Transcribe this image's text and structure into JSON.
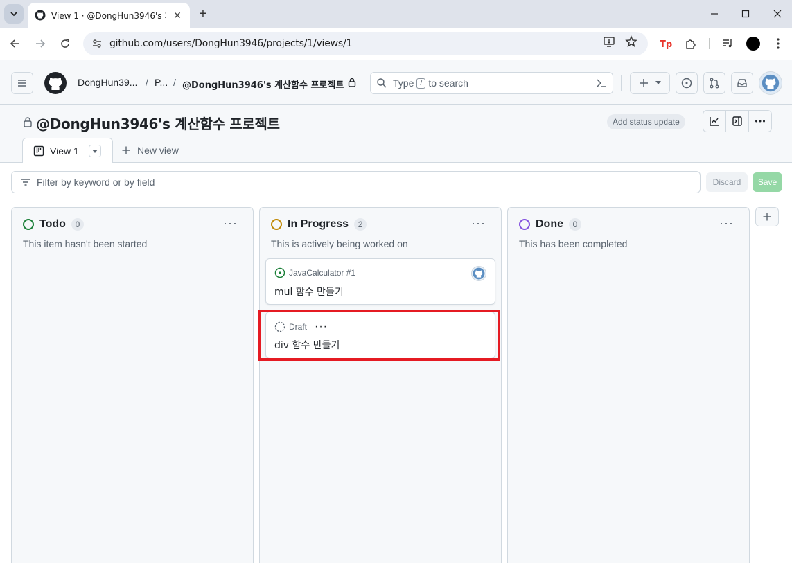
{
  "browser": {
    "tab_title": "View 1 · @DongHun3946's 계산함수 프로젝트",
    "url": "github.com/users/DongHun3946/projects/1/views/1"
  },
  "header": {
    "breadcrumb_owner": "DongHun39...",
    "breadcrumb_sep": "/",
    "breadcrumb_projects": "P...",
    "breadcrumb_project": "@DongHun3946's 계산함수 프로젝트",
    "search_prefix": "Type",
    "search_key": "/",
    "search_suffix": "to search"
  },
  "project": {
    "title": "@DongHun3946's 계산함수 프로젝트",
    "status_update_label": "Add status update",
    "view_tab_label": "View 1",
    "new_view_label": "New view"
  },
  "filter": {
    "placeholder": "Filter by keyword or by field",
    "discard_label": "Discard",
    "save_label": "Save"
  },
  "columns": [
    {
      "name": "Todo",
      "count": "0",
      "description": "This item hasn't been started",
      "color": "#1a7f37"
    },
    {
      "name": "In Progress",
      "count": "2",
      "description": "This is actively being worked on",
      "color": "#bf8700"
    },
    {
      "name": "Done",
      "count": "0",
      "description": "This has been completed",
      "color": "#8250df"
    }
  ],
  "cards": [
    {
      "meta": "JavaCalculator #1",
      "title": "mul 함수 만들기"
    },
    {
      "meta": "Draft",
      "title": "div 함수 만들기"
    }
  ],
  "colors": {
    "highlight": "#e51b23",
    "save_button": "#95d8a6"
  }
}
